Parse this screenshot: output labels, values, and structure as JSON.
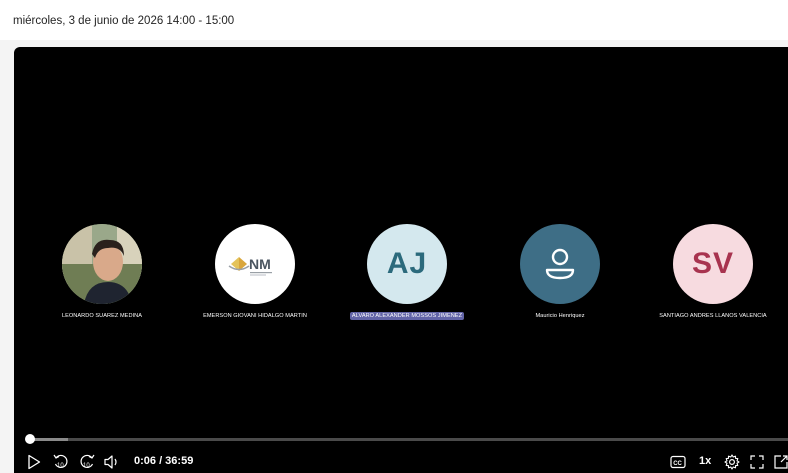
{
  "meeting": {
    "date_time": "miércoles, 3 de junio de 2026 14:00 - 15:00"
  },
  "participants": [
    {
      "name": "LEONARDO SUAREZ MEDINA",
      "avatar_type": "photo",
      "initials": ""
    },
    {
      "name": "EMERSON GIOVANI HIDALGO MARTIN",
      "avatar_type": "logo",
      "initials": "NM"
    },
    {
      "name": "ALVARO ALEXANDER MOSSOS JIMENEZ",
      "avatar_type": "initials",
      "initials": "AJ",
      "speaking": true
    },
    {
      "name": "Mauricio Henriquez",
      "avatar_type": "generic",
      "initials": ""
    },
    {
      "name": "SANTIAGO ANDRES LLANOS VALENCIA",
      "avatar_type": "initials",
      "initials": "SV"
    }
  ],
  "player": {
    "time_display": "0:06 / 36:59",
    "speed": "1x",
    "progress_fraction": 0.0027,
    "buffered_fraction": 0.05
  },
  "controls": {
    "play_icon": "play-icon",
    "rewind_icon": "rewind-10-icon",
    "forward_icon": "forward-10-icon",
    "volume_icon": "volume-icon",
    "captions_icon": "closed-captions-icon",
    "settings_icon": "gear-icon",
    "fullscreen_icon": "fullscreen-icon",
    "popout_icon": "popout-icon"
  },
  "colors": {
    "player_bg": "#000000",
    "speaking_highlight": "#6264a7",
    "aj_avatar_bg": "#d4e8ee",
    "aj_avatar_fg": "#2b6a7c",
    "sv_avatar_bg": "#f7dbe0",
    "sv_avatar_fg": "#a8334f",
    "generic_avatar_bg": "#3e6e86"
  }
}
